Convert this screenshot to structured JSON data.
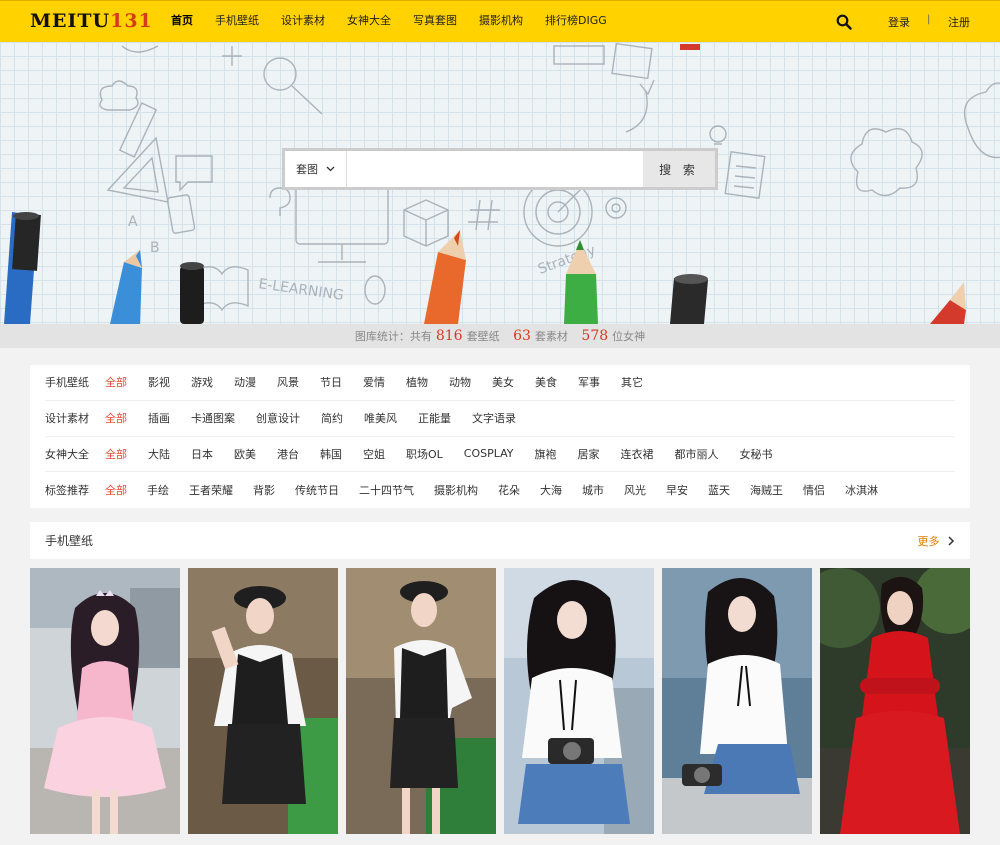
{
  "header": {
    "logo_main": "MEITU",
    "logo_accent": "131",
    "nav": [
      "首页",
      "手机壁纸",
      "设计素材",
      "女神大全",
      "写真套图",
      "摄影机构",
      "排行榜DIGG"
    ],
    "login": "登录",
    "separator": "|",
    "register": "注册"
  },
  "search": {
    "select_value": "套图",
    "input_value": "",
    "button": "搜 索"
  },
  "stats": {
    "prefix": "图库统计：共有",
    "wallpaper_count": "816",
    "wallpaper_unit": "套壁纸",
    "material_count": "63",
    "material_unit": "套素材",
    "goddess_count": "578",
    "goddess_unit": "位女神"
  },
  "filters": [
    {
      "label": "手机壁纸",
      "tags": [
        "全部",
        "影视",
        "游戏",
        "动漫",
        "风景",
        "节日",
        "爱情",
        "植物",
        "动物",
        "美女",
        "美食",
        "军事",
        "其它"
      ]
    },
    {
      "label": "设计素材",
      "tags": [
        "全部",
        "插画",
        "卡通图案",
        "创意设计",
        "简约",
        "唯美风",
        "正能量",
        "文字语录"
      ]
    },
    {
      "label": "女神大全",
      "tags": [
        "全部",
        "大陆",
        "日本",
        "欧美",
        "港台",
        "韩国",
        "空姐",
        "职场OL",
        "COSPLAY",
        "旗袍",
        "居家",
        "连衣裙",
        "都市丽人",
        "女秘书"
      ]
    },
    {
      "label": "标签推荐",
      "tags": [
        "全部",
        "手绘",
        "王者荣耀",
        "背影",
        "传统节日",
        "二十四节气",
        "摄影机构",
        "花朵",
        "大海",
        "城市",
        "风光",
        "早安",
        "蓝天",
        "海贼王",
        "情侣",
        "冰淇淋"
      ]
    }
  ],
  "section": {
    "title": "手机壁纸",
    "more": "更多"
  },
  "colors": {
    "header_bg": "#ffd200",
    "accent_red": "#e04b2f",
    "more_orange": "#e07b00"
  }
}
